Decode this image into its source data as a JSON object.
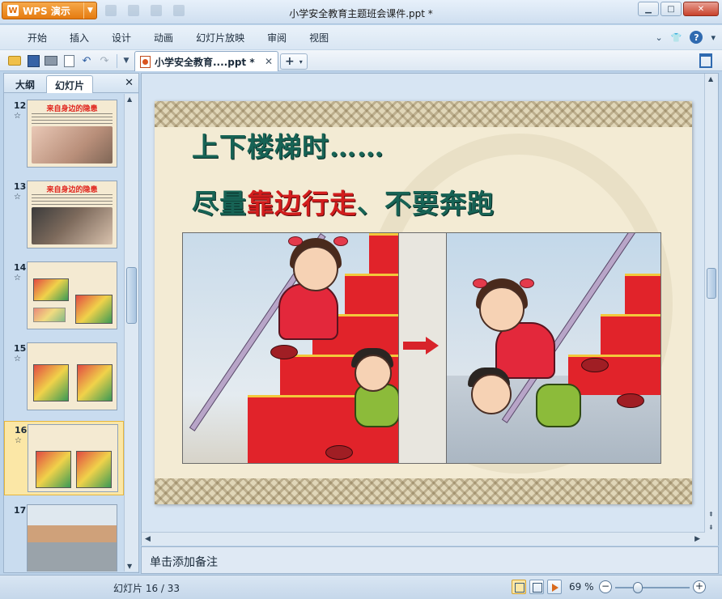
{
  "app": {
    "name": "WPS 演示",
    "document_title": "小学安全教育主题班会课件.ppt *"
  },
  "menu": {
    "items": [
      "开始",
      "插入",
      "设计",
      "动画",
      "幻灯片放映",
      "审阅",
      "视图"
    ]
  },
  "toolbar": {
    "doc_tab_label": "小学安全教育....ppt *",
    "new_tab_label": "+"
  },
  "left_panel": {
    "tabs": [
      "大纲",
      "幻灯片"
    ],
    "active_tab": "幻灯片",
    "thumbnails": [
      {
        "number": "12",
        "title": "来自身边的隐患"
      },
      {
        "number": "13",
        "title": "来自身边的隐患"
      },
      {
        "number": "14",
        "title": ""
      },
      {
        "number": "15",
        "title": ""
      },
      {
        "number": "16",
        "title": ""
      },
      {
        "number": "17",
        "title": ""
      }
    ],
    "selected_number": "16"
  },
  "slide": {
    "heading": "上下楼梯时……",
    "sub_prefix": "尽量",
    "sub_highlight": "靠边行走",
    "sub_suffix": "、不要奔跑"
  },
  "notes": {
    "placeholder": "单击添加备注"
  },
  "status": {
    "slide_info": "幻灯片 16 / 33",
    "zoom": "69 %",
    "zoom_percent": 69
  },
  "colors": {
    "accent": "#e57b10",
    "heading": "#176355",
    "highlight": "#d21d1d",
    "selection": "#fbe7a6"
  }
}
